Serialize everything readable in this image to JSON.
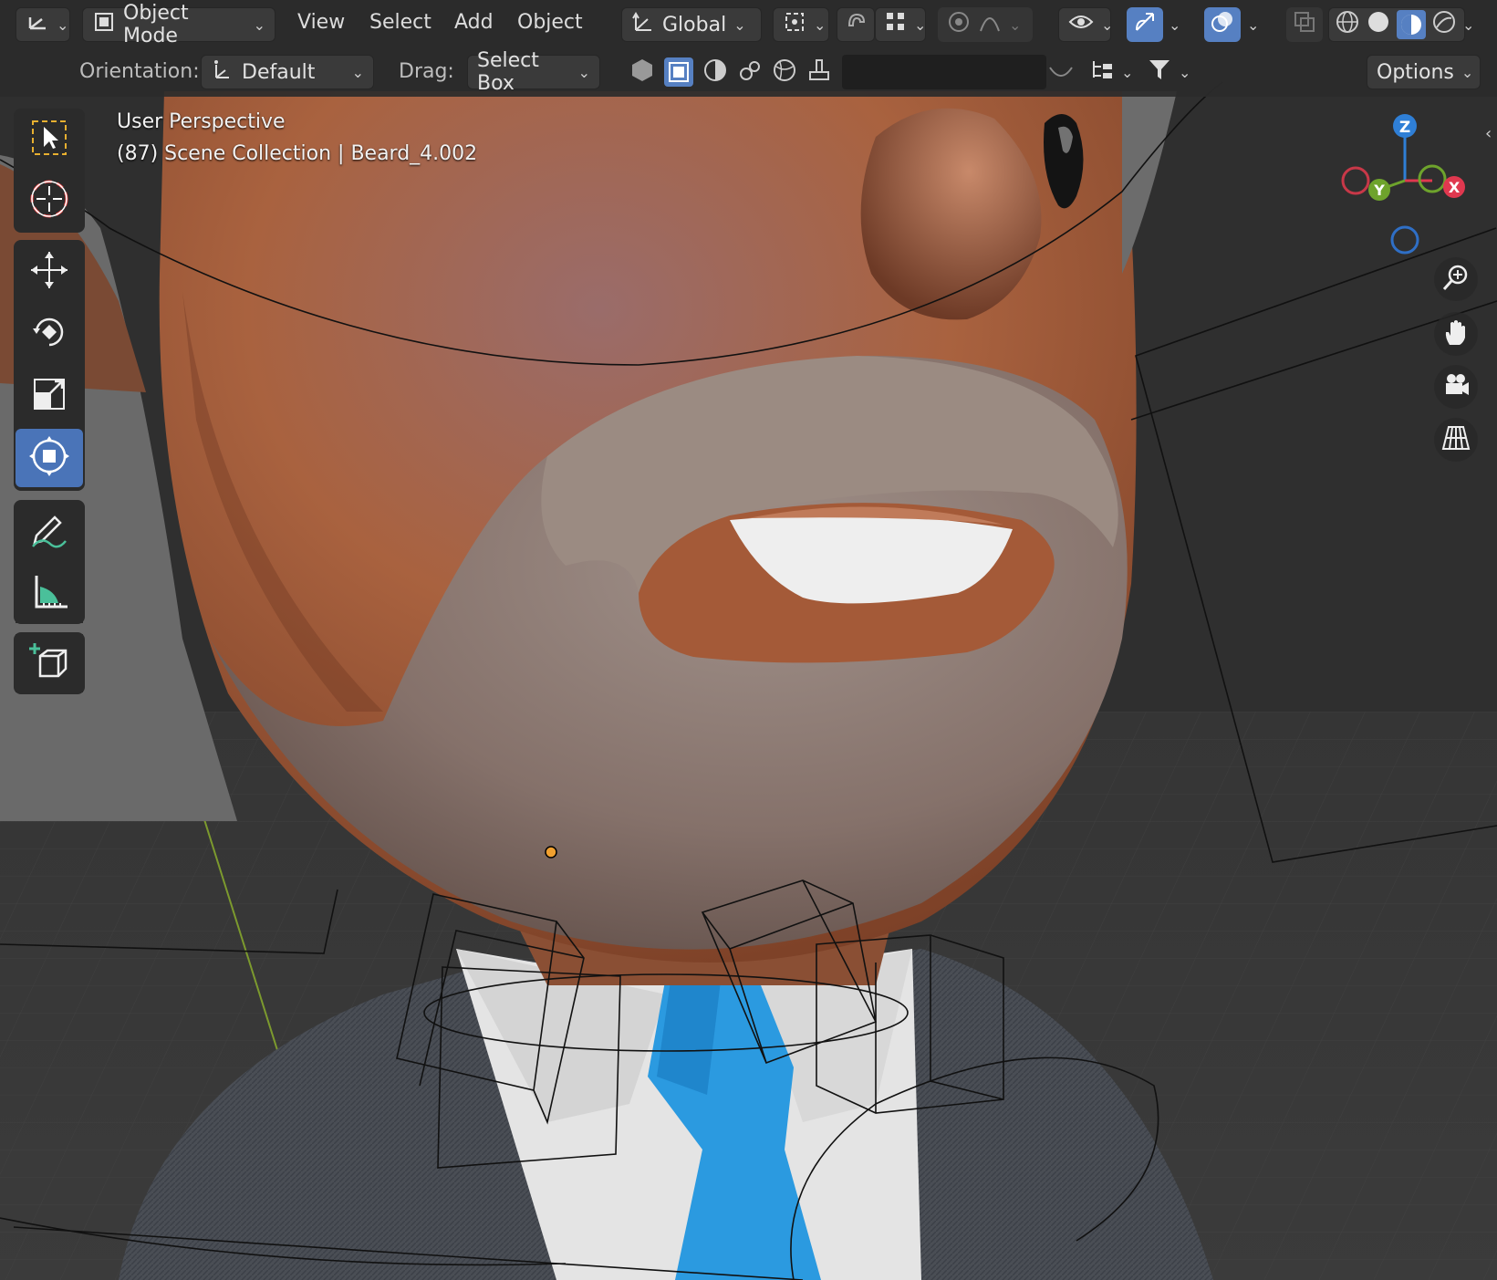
{
  "header": {
    "mode_label": "Object Mode",
    "menus": [
      "View",
      "Select",
      "Add",
      "Object"
    ],
    "transform_orientation": "Global"
  },
  "tool_settings": {
    "orientation_label": "Orientation:",
    "orientation_value": "Default",
    "drag_label": "Drag:",
    "drag_value": "Select Box",
    "search_placeholder": "",
    "options_label": "Options"
  },
  "viewport": {
    "view_name": "User Perspective",
    "object_info": "(87) Scene Collection | Beard_4.002"
  },
  "gizmo": {
    "z_label": "Z",
    "y_label": "Y",
    "x_label": "X",
    "colors": {
      "x": "#e0384f",
      "y": "#6ea32c",
      "z": "#2f7fd6"
    }
  },
  "toolbar": {
    "tools": [
      "select-box",
      "cursor",
      "move",
      "rotate",
      "scale",
      "transform",
      "annotate",
      "measure",
      "add-cube"
    ],
    "active_tool": "transform"
  },
  "colors": {
    "accent": "#5680c2",
    "skin": "#b06a45",
    "beard": "#8f7a6d",
    "tie": "#2b9ae0",
    "suit": "#484c53",
    "shirt": "#e6e6e6"
  }
}
